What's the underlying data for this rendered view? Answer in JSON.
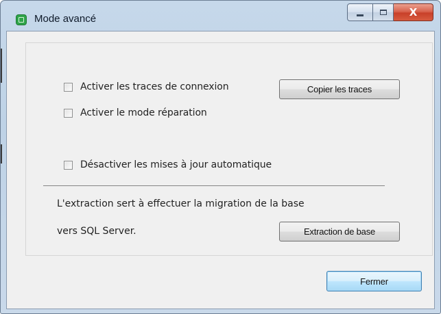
{
  "window": {
    "title": "Mode avancé",
    "icon": "app-icon",
    "controls": {
      "minimize": "minimize-icon",
      "maximize": "maximize-icon",
      "close": "close-icon"
    },
    "close_glyph": "X"
  },
  "options": {
    "trace_checkbox": {
      "label": "Activer les traces de connexion",
      "checked": false
    },
    "copy_traces_button": "Copier les traces",
    "repair_checkbox": {
      "label": "Activer le mode réparation",
      "checked": false
    },
    "disable_updates_checkbox": {
      "label": "Désactiver les mises à jour automatique",
      "checked": false
    }
  },
  "extraction": {
    "line1": "L'extraction sert à effectuer la migration de la base",
    "line2": "vers SQL Server.",
    "button": "Extraction de base"
  },
  "footer": {
    "close_button": "Fermer"
  }
}
